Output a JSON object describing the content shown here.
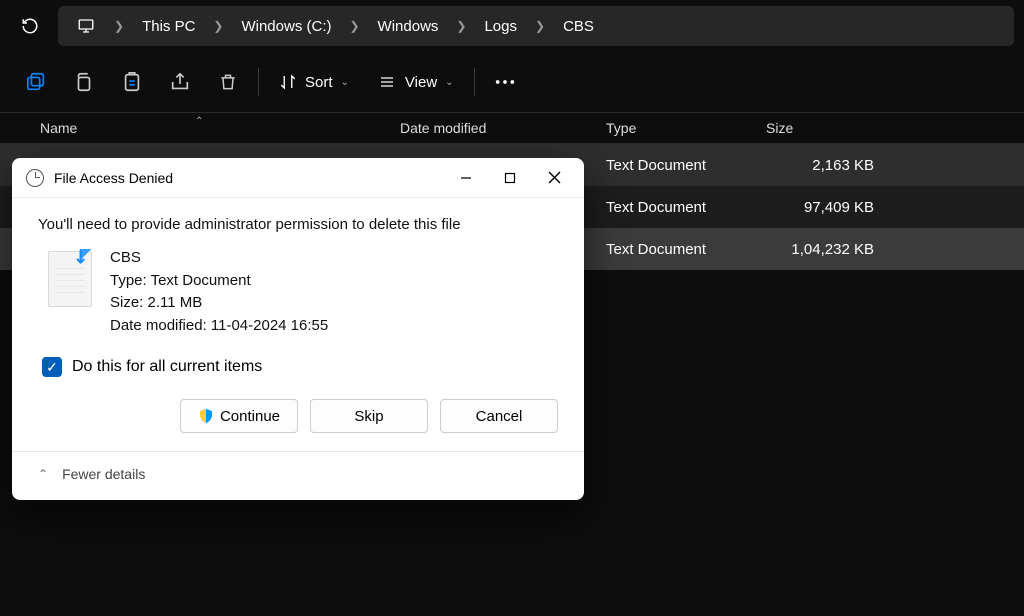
{
  "breadcrumbs": [
    "This PC",
    "Windows (C:)",
    "Windows",
    "Logs",
    "CBS"
  ],
  "toolbar": {
    "sort": "Sort",
    "view": "View"
  },
  "columns": {
    "name": "Name",
    "date": "Date modified",
    "type": "Type",
    "size": "Size"
  },
  "files": [
    {
      "type": "Text Document",
      "size": "2,163 KB"
    },
    {
      "type": "Text Document",
      "size": "97,409 KB"
    },
    {
      "type": "Text Document",
      "size": "1,04,232 KB"
    }
  ],
  "dialog": {
    "title": "File Access Denied",
    "message": "You'll need to provide administrator permission to delete this file",
    "file": {
      "name": "CBS",
      "type_label": "Type: Text Document",
      "size_label": "Size: 2.11 MB",
      "date_label": "Date modified: 11-04-2024 16:55"
    },
    "checkbox_label": "Do this for all current items",
    "buttons": {
      "continue": "Continue",
      "skip": "Skip",
      "cancel": "Cancel"
    },
    "fewer_details": "Fewer details"
  }
}
